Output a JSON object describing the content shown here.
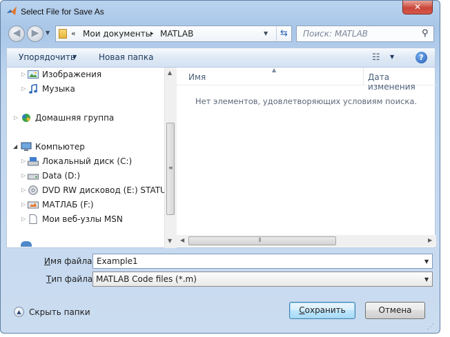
{
  "window": {
    "title": "Select File for Save As",
    "close_label": "✕"
  },
  "address": {
    "crumbs": [
      "Мои документы",
      "MATLAB"
    ],
    "overflow_label": "«",
    "separator": "▸"
  },
  "search": {
    "placeholder": "Поиск: MATLAB"
  },
  "toolbar": {
    "organize_label": "Упорядочить",
    "new_folder_label": "Новая папка"
  },
  "nav_tree": {
    "items": [
      {
        "label": "Изображения",
        "icon": "pictures-icon"
      },
      {
        "label": "Музыка",
        "icon": "music-icon"
      },
      {
        "label": "Домашняя группа",
        "icon": "homegroup-icon"
      },
      {
        "label": "Компьютер",
        "icon": "computer-icon"
      },
      {
        "label": "Локальный диск (C:)",
        "icon": "local-disk-icon"
      },
      {
        "label": "Data (D:)",
        "icon": "drive-icon"
      },
      {
        "label": "DVD RW дисковод (E:) STATUT",
        "icon": "dvd-drive-icon"
      },
      {
        "label": "МАТЛАБ (F:)",
        "icon": "removable-drive-icon"
      },
      {
        "label": "Мои веб-узлы MSN",
        "icon": "msn-page-icon"
      }
    ]
  },
  "file_list": {
    "col_name": "Имя",
    "col_date": "Дата изменения",
    "empty_message": "Нет элементов, удовлетворяющих условиям поиска."
  },
  "form": {
    "filename_label_key": "И",
    "filename_label_rest": "мя файла:",
    "filename_value": "Example1",
    "filetype_label_key": "Т",
    "filetype_label_rest": "ип файла:",
    "filetype_value": "MATLAB Code files (*.m)"
  },
  "footer": {
    "hide_folders_label": "Скрыть папки",
    "save_label_key": "С",
    "save_label_rest": "охранить",
    "cancel_label": "Отмена"
  },
  "colors": {
    "frame": "#b9d3ee",
    "close_button": "#c9463a",
    "accent": "#3c7fb1"
  }
}
